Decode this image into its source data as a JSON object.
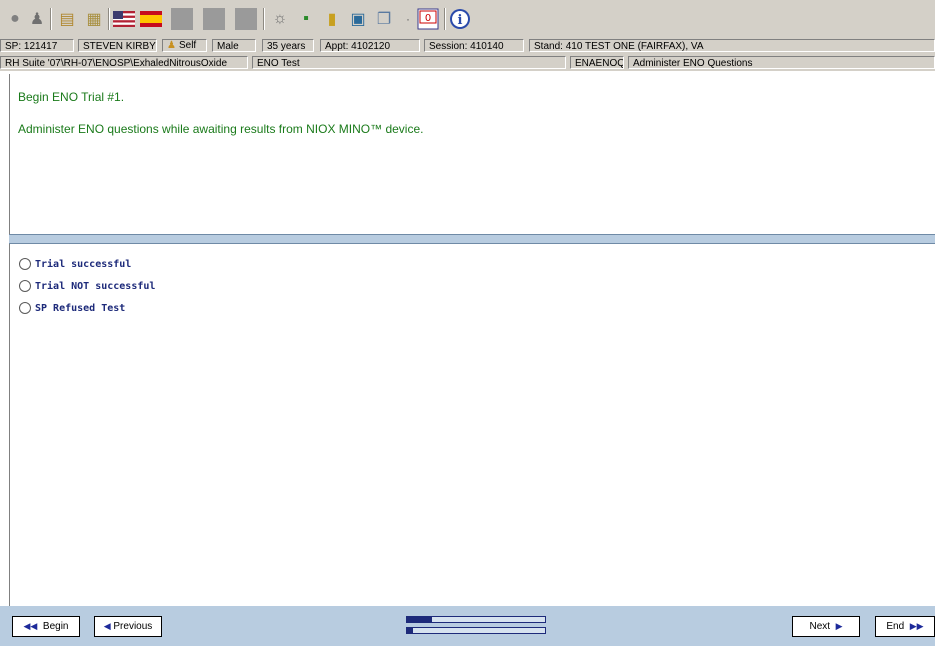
{
  "toolbar": {
    "icons": [
      "puzzle-icon",
      "person-icon",
      "people-card-icon",
      "notepad-icon",
      "us-flag-icon",
      "spain-flag-icon",
      "gray-block-icon",
      "gray-block-icon",
      "gray-block-icon",
      "satellite-icon",
      "chart-icon",
      "ruler-icon",
      "monitor-check-icon",
      "copy-icon",
      "power-icon",
      "info-icon"
    ]
  },
  "infobar": {
    "sp": "SP: 121417",
    "name": "STEVEN KIRBY",
    "respondent": "Self",
    "gender": "Male",
    "age": "35 years",
    "appt": "Appt: 4102120",
    "session": "Session: 410140",
    "stand": "Stand: 410 TEST ONE (FAIRFAX), VA"
  },
  "pathbar": {
    "path": "RH Suite '07\\RH-07\\ENOSP\\ExhaledNitrousOxide",
    "section": "ENO Test",
    "code": "ENAENOQ",
    "question_title": "Administer ENO Questions"
  },
  "instructions": {
    "line1": "Begin ENO Trial #1.",
    "line2": "Administer ENO questions while awaiting results from NIOX MINO™ device."
  },
  "options": [
    "Trial successful",
    "Trial NOT successful",
    "SP Refused Test"
  ],
  "nav": {
    "begin": "Begin",
    "previous": "Previous",
    "next": "Next",
    "end": "End"
  },
  "progress": {
    "section_fraction": 0.18,
    "overall_fraction": 0.04
  },
  "colors": {
    "instruction_text": "#1a7a1a",
    "option_text": "#1d2a7a",
    "footer_bg": "#b8cce0",
    "toolbar_bg": "#d4d0c8"
  }
}
